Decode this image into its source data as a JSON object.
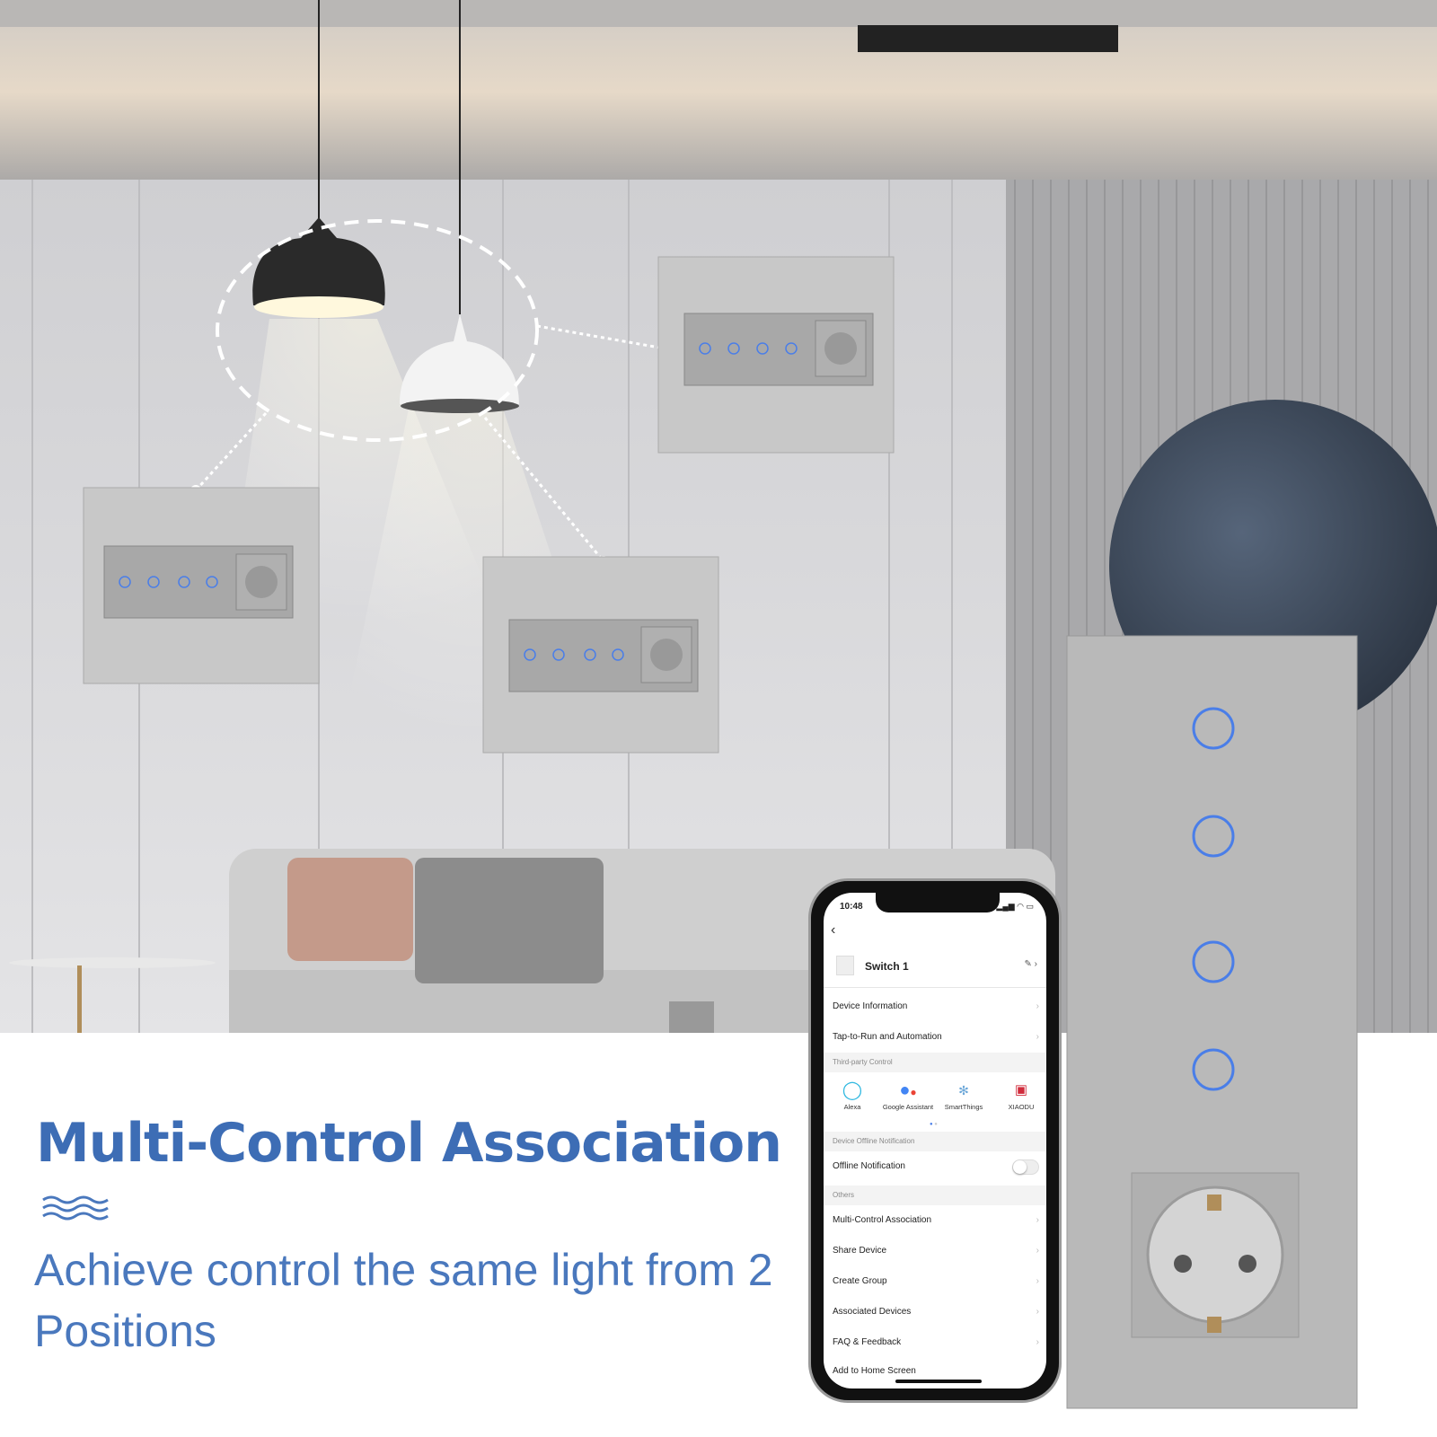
{
  "headline": "Multi-Control Association",
  "subtitle": "Achieve control the same light from 2 Positions",
  "colors": {
    "accent": "#3d6db5",
    "touch_ring": "#4a7ee8",
    "panel": "#b9b9b9"
  },
  "phone": {
    "time": "10:48",
    "status_icons": [
      "signal-icon",
      "wifi-icon",
      "battery-icon"
    ],
    "device_name": "Switch 1",
    "rows_top": [
      "Device Information",
      "Tap-to-Run and Automation"
    ],
    "third_party_header": "Third-party Control",
    "third_party": [
      {
        "label": "Alexa",
        "icon": "alexa-icon"
      },
      {
        "label": "Google Assistant",
        "icon": "google-assistant-icon"
      },
      {
        "label": "SmartThings",
        "icon": "smartthings-icon"
      },
      {
        "label": "XIAODU",
        "icon": "xiaodu-icon"
      }
    ],
    "offline_header": "Device Offline Notification",
    "offline_label": "Offline Notification",
    "offline_enabled": false,
    "others_header": "Others",
    "others": [
      "Multi-Control Association",
      "Share Device",
      "Create Group",
      "Associated Devices",
      "FAQ & Feedback",
      "Add to Home Screen"
    ]
  }
}
